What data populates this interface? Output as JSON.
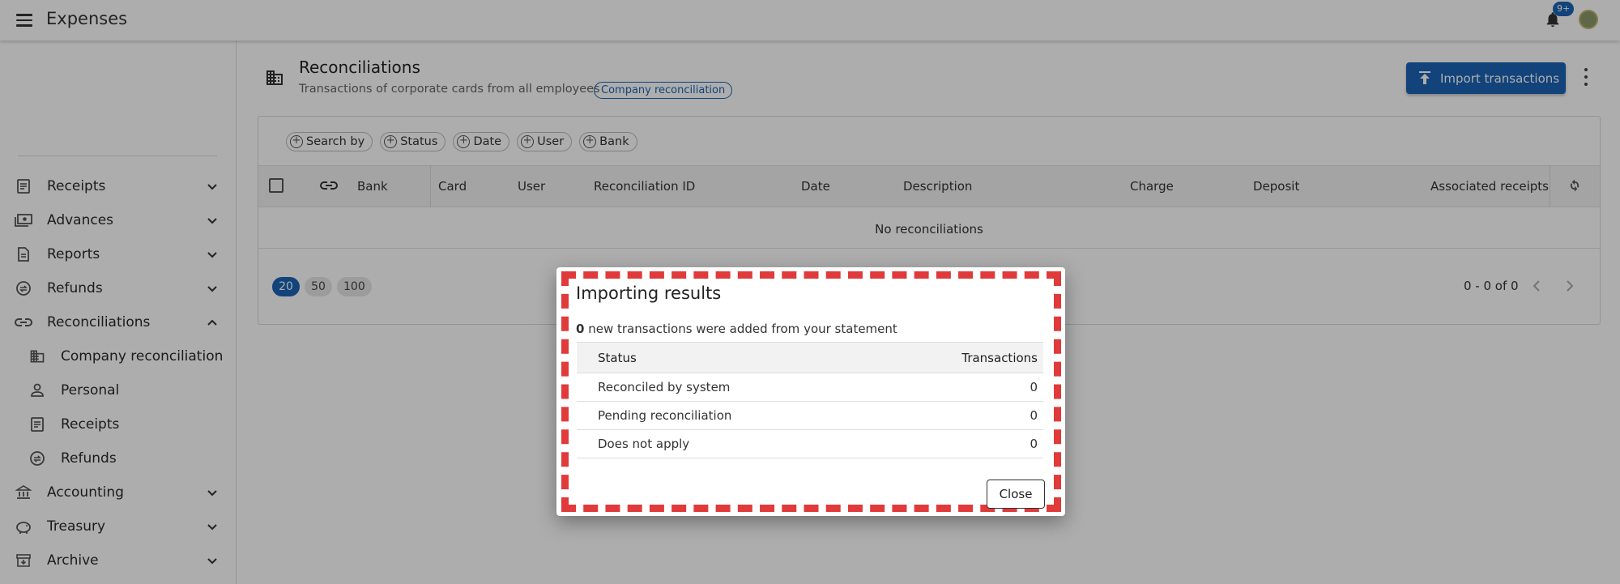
{
  "app": {
    "title": "Expenses",
    "notification_badge": "9+"
  },
  "sidebar": {
    "items": [
      {
        "label": "Receipts",
        "icon": "receipt-icon",
        "chevron": "down"
      },
      {
        "label": "Advances",
        "icon": "cash-icon",
        "chevron": "down"
      },
      {
        "label": "Reports",
        "icon": "report-icon",
        "chevron": "down"
      },
      {
        "label": "Refunds",
        "icon": "refund-icon",
        "chevron": "down"
      },
      {
        "label": "Reconciliations",
        "icon": "link-icon",
        "chevron": "up"
      },
      {
        "label": "Company reconciliation",
        "icon": "building-icon",
        "sub": true
      },
      {
        "label": "Personal",
        "icon": "person-icon",
        "sub": true
      },
      {
        "label": "Receipts",
        "icon": "receipt-icon",
        "sub": true
      },
      {
        "label": "Refunds",
        "icon": "refund-icon",
        "sub": true
      },
      {
        "label": "Accounting",
        "icon": "bank-icon",
        "chevron": "down"
      },
      {
        "label": "Treasury",
        "icon": "piggy-bank-icon",
        "chevron": "down"
      },
      {
        "label": "Archive",
        "icon": "archive-icon",
        "chevron": "down"
      }
    ]
  },
  "page": {
    "title": "Reconciliations",
    "subtitle": "Transactions of corporate cards from all employees",
    "chip": "Company reconciliation",
    "import_button": "Import transactions"
  },
  "filters": [
    "Search by",
    "Status",
    "Date",
    "User",
    "Bank"
  ],
  "table": {
    "columns": [
      "Bank",
      "Card",
      "User",
      "Reconciliation ID",
      "Date",
      "Description",
      "Charge",
      "Deposit",
      "Associated receipts"
    ],
    "empty_message": "No reconciliations"
  },
  "pagination": {
    "sizes": [
      "20",
      "50",
      "100"
    ],
    "active": "20",
    "range": "0 - 0 of 0"
  },
  "dialog": {
    "title": "Importing results",
    "summary_count": "0",
    "summary_text": "new transactions were added from your statement",
    "columns": {
      "status": "Status",
      "transactions": "Transactions"
    },
    "rows": [
      {
        "status": "Reconciled by system",
        "count": "0"
      },
      {
        "status": "Pending reconciliation",
        "count": "0"
      },
      {
        "status": "Does not apply",
        "count": "0"
      }
    ],
    "close_button": "Close"
  },
  "colors": {
    "accent": "#1b63b5",
    "highlight_frame": "#e03a3a"
  }
}
